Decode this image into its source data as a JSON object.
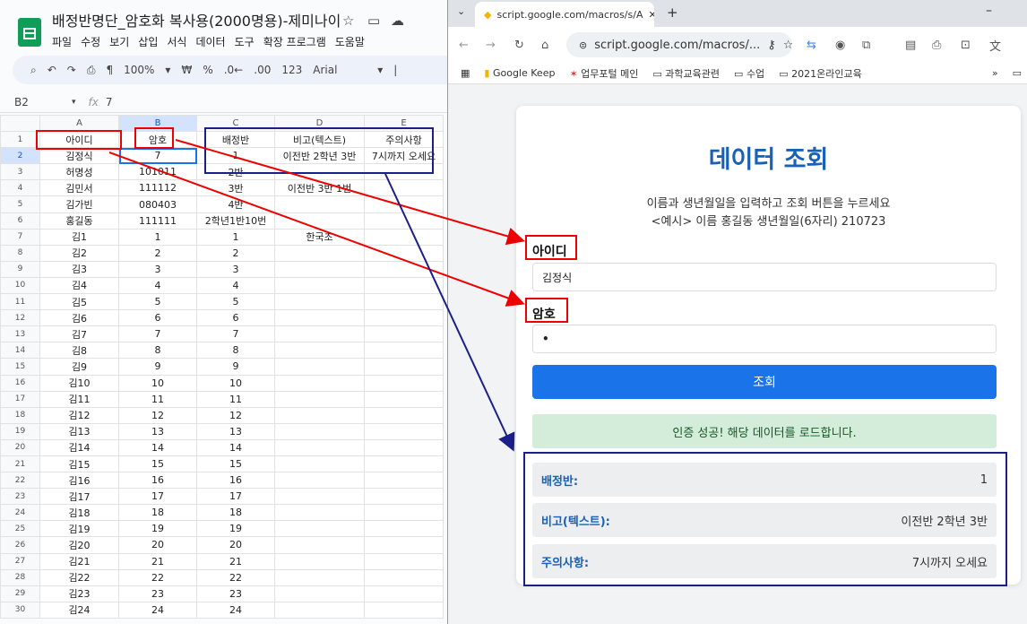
{
  "sheet": {
    "title": "배정반명단_암호화 복사용(2000명용)-제미나이",
    "menu": [
      "파일",
      "수정",
      "보기",
      "삽입",
      "서식",
      "데이터",
      "도구",
      "확장 프로그램",
      "도움말"
    ],
    "toolbar": {
      "zoom": "100%",
      "currency": "₩",
      "percent": "%",
      "dec_minus": ".0←",
      "dec_plus": ".00",
      "num123": "123",
      "font": "Arial"
    },
    "formula_bar": {
      "cell_ref": "B2",
      "fx": "fx",
      "value": "7"
    },
    "columns": [
      "A",
      "B",
      "C",
      "D",
      "E"
    ],
    "rows": [
      {
        "n": "1",
        "a": "아이디",
        "b": "암호",
        "c": "배정반",
        "d": "비고(텍스트)",
        "e": "주의사항"
      },
      {
        "n": "2",
        "a": "김정식",
        "b": "7",
        "c": "1",
        "d": "이전반 2학년 3반",
        "e": "7시까지 오세요"
      },
      {
        "n": "3",
        "a": "허명성",
        "b": "101011",
        "c": "2반",
        "d": "",
        "e": ""
      },
      {
        "n": "4",
        "a": "김민서",
        "b": "111112",
        "c": "3반",
        "d": "이전반 3반 1번",
        "e": ""
      },
      {
        "n": "5",
        "a": "김가빈",
        "b": "080403",
        "c": "4반",
        "d": "",
        "e": ""
      },
      {
        "n": "6",
        "a": "홍길동",
        "b": "111111",
        "c": "2학년1반10번",
        "d": "",
        "e": ""
      },
      {
        "n": "7",
        "a": "김1",
        "b": "1",
        "c": "1",
        "d": "한국초",
        "e": ""
      },
      {
        "n": "8",
        "a": "김2",
        "b": "2",
        "c": "2",
        "d": "",
        "e": ""
      },
      {
        "n": "9",
        "a": "김3",
        "b": "3",
        "c": "3",
        "d": "",
        "e": ""
      },
      {
        "n": "10",
        "a": "김4",
        "b": "4",
        "c": "4",
        "d": "",
        "e": ""
      },
      {
        "n": "11",
        "a": "김5",
        "b": "5",
        "c": "5",
        "d": "",
        "e": ""
      },
      {
        "n": "12",
        "a": "김6",
        "b": "6",
        "c": "6",
        "d": "",
        "e": ""
      },
      {
        "n": "13",
        "a": "김7",
        "b": "7",
        "c": "7",
        "d": "",
        "e": ""
      },
      {
        "n": "14",
        "a": "김8",
        "b": "8",
        "c": "8",
        "d": "",
        "e": ""
      },
      {
        "n": "15",
        "a": "김9",
        "b": "9",
        "c": "9",
        "d": "",
        "e": ""
      },
      {
        "n": "16",
        "a": "김10",
        "b": "10",
        "c": "10",
        "d": "",
        "e": ""
      },
      {
        "n": "17",
        "a": "김11",
        "b": "11",
        "c": "11",
        "d": "",
        "e": ""
      },
      {
        "n": "18",
        "a": "김12",
        "b": "12",
        "c": "12",
        "d": "",
        "e": ""
      },
      {
        "n": "19",
        "a": "김13",
        "b": "13",
        "c": "13",
        "d": "",
        "e": ""
      },
      {
        "n": "20",
        "a": "김14",
        "b": "14",
        "c": "14",
        "d": "",
        "e": ""
      },
      {
        "n": "21",
        "a": "김15",
        "b": "15",
        "c": "15",
        "d": "",
        "e": ""
      },
      {
        "n": "22",
        "a": "김16",
        "b": "16",
        "c": "16",
        "d": "",
        "e": ""
      },
      {
        "n": "23",
        "a": "김17",
        "b": "17",
        "c": "17",
        "d": "",
        "e": ""
      },
      {
        "n": "24",
        "a": "김18",
        "b": "18",
        "c": "18",
        "d": "",
        "e": ""
      },
      {
        "n": "25",
        "a": "김19",
        "b": "19",
        "c": "19",
        "d": "",
        "e": ""
      },
      {
        "n": "26",
        "a": "김20",
        "b": "20",
        "c": "20",
        "d": "",
        "e": ""
      },
      {
        "n": "27",
        "a": "김21",
        "b": "21",
        "c": "21",
        "d": "",
        "e": ""
      },
      {
        "n": "28",
        "a": "김22",
        "b": "22",
        "c": "22",
        "d": "",
        "e": ""
      },
      {
        "n": "29",
        "a": "김23",
        "b": "23",
        "c": "23",
        "d": "",
        "e": ""
      },
      {
        "n": "30",
        "a": "김24",
        "b": "24",
        "c": "24",
        "d": "",
        "e": ""
      }
    ]
  },
  "browser": {
    "tab_title": "script.google.com/macros/s/A",
    "url": "script.google.com/macros/...",
    "bookmarks": [
      "Google Keep",
      "업무포털 메인",
      "과학교육관련",
      "수업",
      "2021온라인교육"
    ],
    "page": {
      "heading": "데이터 조회",
      "desc_line1": "이름과 생년월일을 입력하고 조회 버튼을 누르세요",
      "desc_line2": "<예시> 이름 홍길동 생년월일(6자리) 210723",
      "id_label": "아이디",
      "id_value": "김정식",
      "pw_label": "암호",
      "pw_value": "•",
      "submit_label": "조회",
      "alert": "인증 성공! 해당 데이터를 로드합니다.",
      "results": [
        {
          "key": "배정반:",
          "value": "1"
        },
        {
          "key": "비고(텍스트):",
          "value": "이전반 2학년 3반"
        },
        {
          "key": "주의사항:",
          "value": "7시까지 오세요"
        }
      ]
    }
  },
  "colors": {
    "sheet_green": "#0f9d58",
    "heading_blue": "#1761b8",
    "button_blue": "#1a73e8",
    "alert_bg": "#d4edda",
    "annotation_red": "#e00000",
    "annotation_navy": "#1a1f8a"
  }
}
